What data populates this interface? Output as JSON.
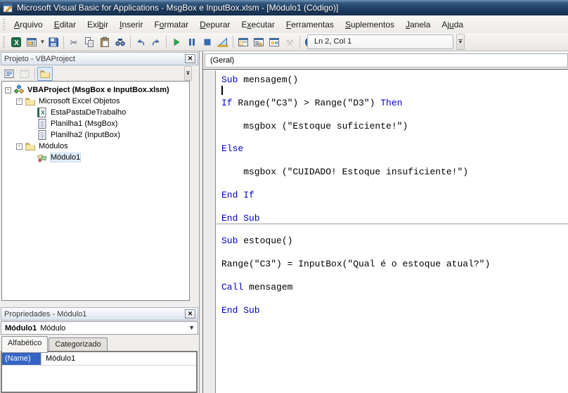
{
  "window": {
    "title": "Microsoft Visual Basic for Applications - MsgBox e InputBox.xlsm - [Módulo1 (Código)]"
  },
  "menu": {
    "items": [
      {
        "label": "Arquivo",
        "accel": 0
      },
      {
        "label": "Editar",
        "accel": 0
      },
      {
        "label": "Exibir",
        "accel": 3
      },
      {
        "label": "Inserir",
        "accel": 0
      },
      {
        "label": "Formatar",
        "accel": 1
      },
      {
        "label": "Depurar",
        "accel": 0
      },
      {
        "label": "Executar",
        "accel": 1
      },
      {
        "label": "Ferramentas",
        "accel": 0
      },
      {
        "label": "Suplementos",
        "accel": 0
      },
      {
        "label": "Janela",
        "accel": 0
      },
      {
        "label": "Ajuda",
        "accel": 2
      }
    ]
  },
  "toolbar": {
    "status": "Ln 2, Col 1",
    "buttons": [
      {
        "name": "view-microsoft-excel-button",
        "icon": "excel"
      },
      {
        "name": "insert-userform-button",
        "icon": "userform",
        "dropdown": true
      },
      {
        "name": "save-button",
        "icon": "save"
      },
      {
        "sep": true
      },
      {
        "name": "cut-button",
        "icon": "cut"
      },
      {
        "name": "copy-button",
        "icon": "copy"
      },
      {
        "name": "paste-button",
        "icon": "paste"
      },
      {
        "name": "find-button",
        "icon": "find"
      },
      {
        "sep": true
      },
      {
        "name": "undo-button",
        "icon": "undo"
      },
      {
        "name": "redo-button",
        "icon": "redo"
      },
      {
        "sep": true
      },
      {
        "name": "run-button",
        "icon": "run"
      },
      {
        "name": "break-button",
        "icon": "break"
      },
      {
        "name": "reset-button",
        "icon": "reset"
      },
      {
        "name": "design-mode-button",
        "icon": "design"
      },
      {
        "sep": true
      },
      {
        "name": "project-explorer-button",
        "icon": "project"
      },
      {
        "name": "properties-window-button",
        "icon": "propswin"
      },
      {
        "name": "object-browser-button",
        "icon": "objbrowser"
      },
      {
        "name": "toolbox-button",
        "icon": "toolbox",
        "disabled": true
      },
      {
        "sep": true
      },
      {
        "name": "help-button",
        "icon": "help"
      }
    ]
  },
  "project": {
    "title": "Projeto - VBAProject",
    "toolbar": [
      {
        "name": "view-code-button",
        "icon": "viewcode"
      },
      {
        "name": "view-object-button",
        "icon": "viewobject",
        "disabled": true
      },
      {
        "sep": true
      },
      {
        "name": "toggle-folders-button",
        "icon": "folder",
        "active": true
      }
    ],
    "tree": [
      {
        "label": "VBAProject (MsgBox e InputBox.xlsm)",
        "icon": "vbaproject",
        "indent": 0,
        "expander": "-",
        "bold": true
      },
      {
        "label": "Microsoft Excel Objetos",
        "icon": "folder",
        "indent": 1,
        "expander": "-"
      },
      {
        "label": "EstaPastaDeTrabalho",
        "icon": "workbook",
        "indent": 2
      },
      {
        "label": "Planilha1 (MsgBox)",
        "icon": "worksheet",
        "indent": 2
      },
      {
        "label": "Planilha2 (InputBox)",
        "icon": "worksheet",
        "indent": 2
      },
      {
        "label": "Módulos",
        "icon": "folder",
        "indent": 1,
        "expander": "-"
      },
      {
        "label": "Módulo1",
        "icon": "module",
        "indent": 2,
        "selected": true
      }
    ]
  },
  "properties": {
    "title": "Propriedades - Módulo1",
    "object_name": "Módulo1",
    "object_type": "Módulo",
    "tabs": [
      {
        "label": "Alfabético",
        "active": true
      },
      {
        "label": "Categorizado",
        "active": false
      }
    ],
    "rows": [
      {
        "name": "(Name)",
        "value": "Módulo1",
        "selected": true
      }
    ]
  },
  "code": {
    "object_dropdown": "(Geral)",
    "lines": [
      {
        "segs": [
          {
            "t": "Sub",
            "kw": true
          },
          {
            "t": " mensagem()"
          }
        ]
      },
      {
        "cursor": true
      },
      {
        "segs": [
          {
            "t": "If",
            "kw": true
          },
          {
            "t": " Range(\"C3\") > Range(\"D3\") "
          },
          {
            "t": "Then",
            "kw": true
          }
        ]
      },
      {},
      {
        "segs": [
          {
            "t": "    msgbox (\"Estoque suficiente!\")"
          }
        ]
      },
      {},
      {
        "segs": [
          {
            "t": "Else",
            "kw": true
          }
        ]
      },
      {},
      {
        "segs": [
          {
            "t": "    msgbox (\"CUIDADO! Estoque insuficiente!\")"
          }
        ]
      },
      {},
      {
        "segs": [
          {
            "t": "End If",
            "kw": true
          }
        ]
      },
      {},
      {
        "segs": [
          {
            "t": "End Sub",
            "kw": true
          }
        ],
        "sep": true
      },
      {},
      {
        "segs": [
          {
            "t": "Sub",
            "kw": true
          },
          {
            "t": " estoque()"
          }
        ]
      },
      {},
      {
        "segs": [
          {
            "t": "Range(\"C3\") = InputBox(\"Qual é o estoque atual?\")"
          }
        ]
      },
      {},
      {
        "segs": [
          {
            "t": "Call",
            "kw": true
          },
          {
            "t": " mensagem"
          }
        ]
      },
      {},
      {
        "segs": [
          {
            "t": "End Sub",
            "kw": true
          }
        ]
      }
    ]
  },
  "colors": {
    "keyword": "#0000cc",
    "text": "#000000",
    "selection": "#3464c4",
    "titlebar": "#1f3e63",
    "excel_green": "#1e7145"
  }
}
